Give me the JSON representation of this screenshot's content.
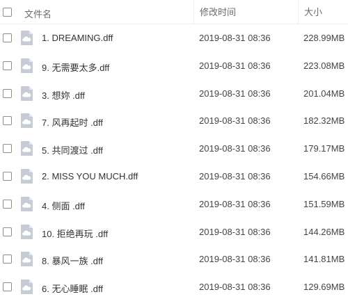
{
  "header": {
    "name_label": "文件名",
    "date_label": "修改时间",
    "size_label": "大小"
  },
  "files": [
    {
      "name": "1. DREAMING.dff",
      "modified": "2019-08-31 08:36",
      "size": "228.99MB"
    },
    {
      "name": "9. 无需要太多.dff",
      "modified": "2019-08-31 08:36",
      "size": "223.08MB"
    },
    {
      "name": "3. 想妳 .dff",
      "modified": "2019-08-31 08:36",
      "size": "201.04MB"
    },
    {
      "name": "7. 风再起时 .dff",
      "modified": "2019-08-31 08:36",
      "size": "182.32MB"
    },
    {
      "name": "5. 共同渡过 .dff",
      "modified": "2019-08-31 08:36",
      "size": "179.17MB"
    },
    {
      "name": "2. MISS YOU MUCH.dff",
      "modified": "2019-08-31 08:36",
      "size": "154.66MB"
    },
    {
      "name": "4. 侧面 .dff",
      "modified": "2019-08-31 08:36",
      "size": "151.59MB"
    },
    {
      "name": "10. 拒绝再玩 .dff",
      "modified": "2019-08-31 08:36",
      "size": "144.26MB"
    },
    {
      "name": "8. 暴风一族 .dff",
      "modified": "2019-08-31 08:36",
      "size": "141.81MB"
    },
    {
      "name": "6. 无心睡眠 .dff",
      "modified": "2019-08-31 08:36",
      "size": "129.69MB"
    }
  ],
  "icons": {
    "file": "cloud-file-icon",
    "select": "checkbox-icon"
  },
  "colors": {
    "header_text": "#666b73",
    "icon_body": "#c5ccd6",
    "icon_cloud": "#ffffff",
    "checkbox_border": "#8c8c8c"
  }
}
